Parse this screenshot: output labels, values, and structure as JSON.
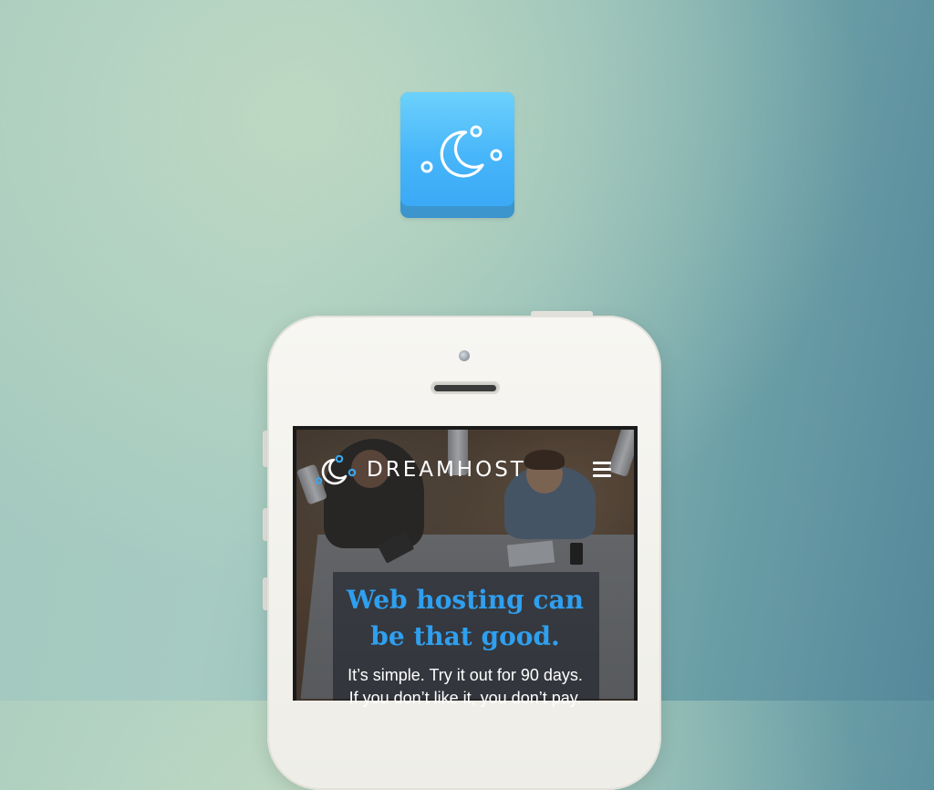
{
  "app_icon": {
    "name": "moon-stars-icon",
    "colors": {
      "top": "#6cd1fb",
      "bottom": "#3ba9f5",
      "base": "#3c95cc"
    }
  },
  "site": {
    "brand": "DREAMHOST",
    "logo_icon": "moon-stars-icon",
    "menu_icon": "hamburger-menu-icon",
    "hero": {
      "title_line1": "Web hosting can",
      "title_line2": "be that good.",
      "subtitle_line1": "It’s simple. Try it out for 90 days.",
      "subtitle_line2": "If you don’t like it, you don’t pay."
    }
  },
  "colors": {
    "accent": "#2f9fef",
    "phone_body": "#f4f3ee"
  }
}
